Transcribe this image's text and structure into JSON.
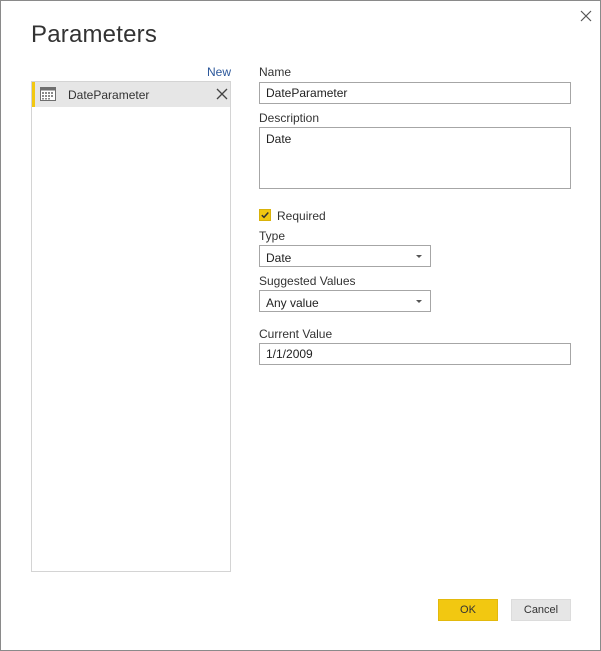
{
  "dialog": {
    "title": "Parameters",
    "new_link": "New",
    "close_icon": "close-icon"
  },
  "parameters": [
    {
      "label": "DateParameter",
      "icon": "calendar-table-icon",
      "selected": true
    }
  ],
  "form": {
    "name_label": "Name",
    "name_value": "DateParameter",
    "description_label": "Description",
    "description_value": "Date",
    "required_label": "Required",
    "required_checked": true,
    "type_label": "Type",
    "type_value": "Date",
    "suggested_label": "Suggested Values",
    "suggested_value": "Any value",
    "current_label": "Current Value",
    "current_value": "1/1/2009"
  },
  "buttons": {
    "ok": "OK",
    "cancel": "Cancel"
  },
  "colors": {
    "accent": "#f2c811",
    "link": "#2b579a",
    "selection_bg": "#e6e6e6"
  }
}
